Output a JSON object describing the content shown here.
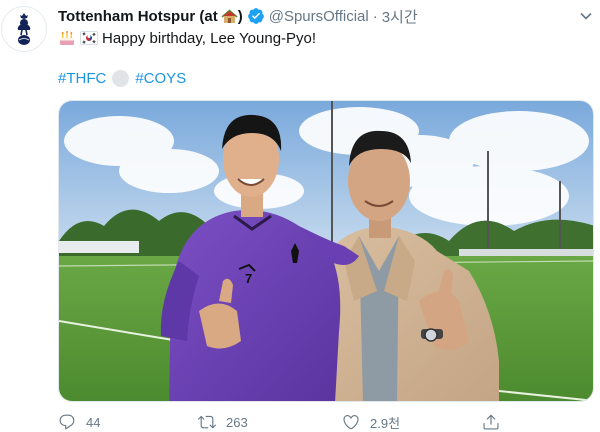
{
  "tweet": {
    "author_name": "Tottenham Hotspur (at",
    "author_suffix": ")",
    "handle": "@SpursOfficial",
    "separator": "·",
    "time": "3시간",
    "text": "Happy birthday, Lee Young-Pyo!",
    "emojis": [
      "cake-emoji",
      "south-korea-flag-emoji"
    ],
    "hashtags": [
      "#THFC",
      "#COYS"
    ],
    "verified": true
  },
  "actions": {
    "reply_count": "44",
    "retweet_count": "263",
    "like_count": "2.9천",
    "share_count": ""
  },
  "colors": {
    "link": "#1b95e0",
    "verified": "#1da1f2",
    "secondary_text": "#657786",
    "spurs_navy": "#132257",
    "kit_purple": "#6a3fb3"
  },
  "icons": {
    "avatar": "spurs-cockerel-logo",
    "home": "house-emoji",
    "caret": "chevron-down-icon",
    "reply": "reply-icon",
    "retweet": "retweet-icon",
    "like": "heart-icon",
    "share": "share-icon"
  }
}
